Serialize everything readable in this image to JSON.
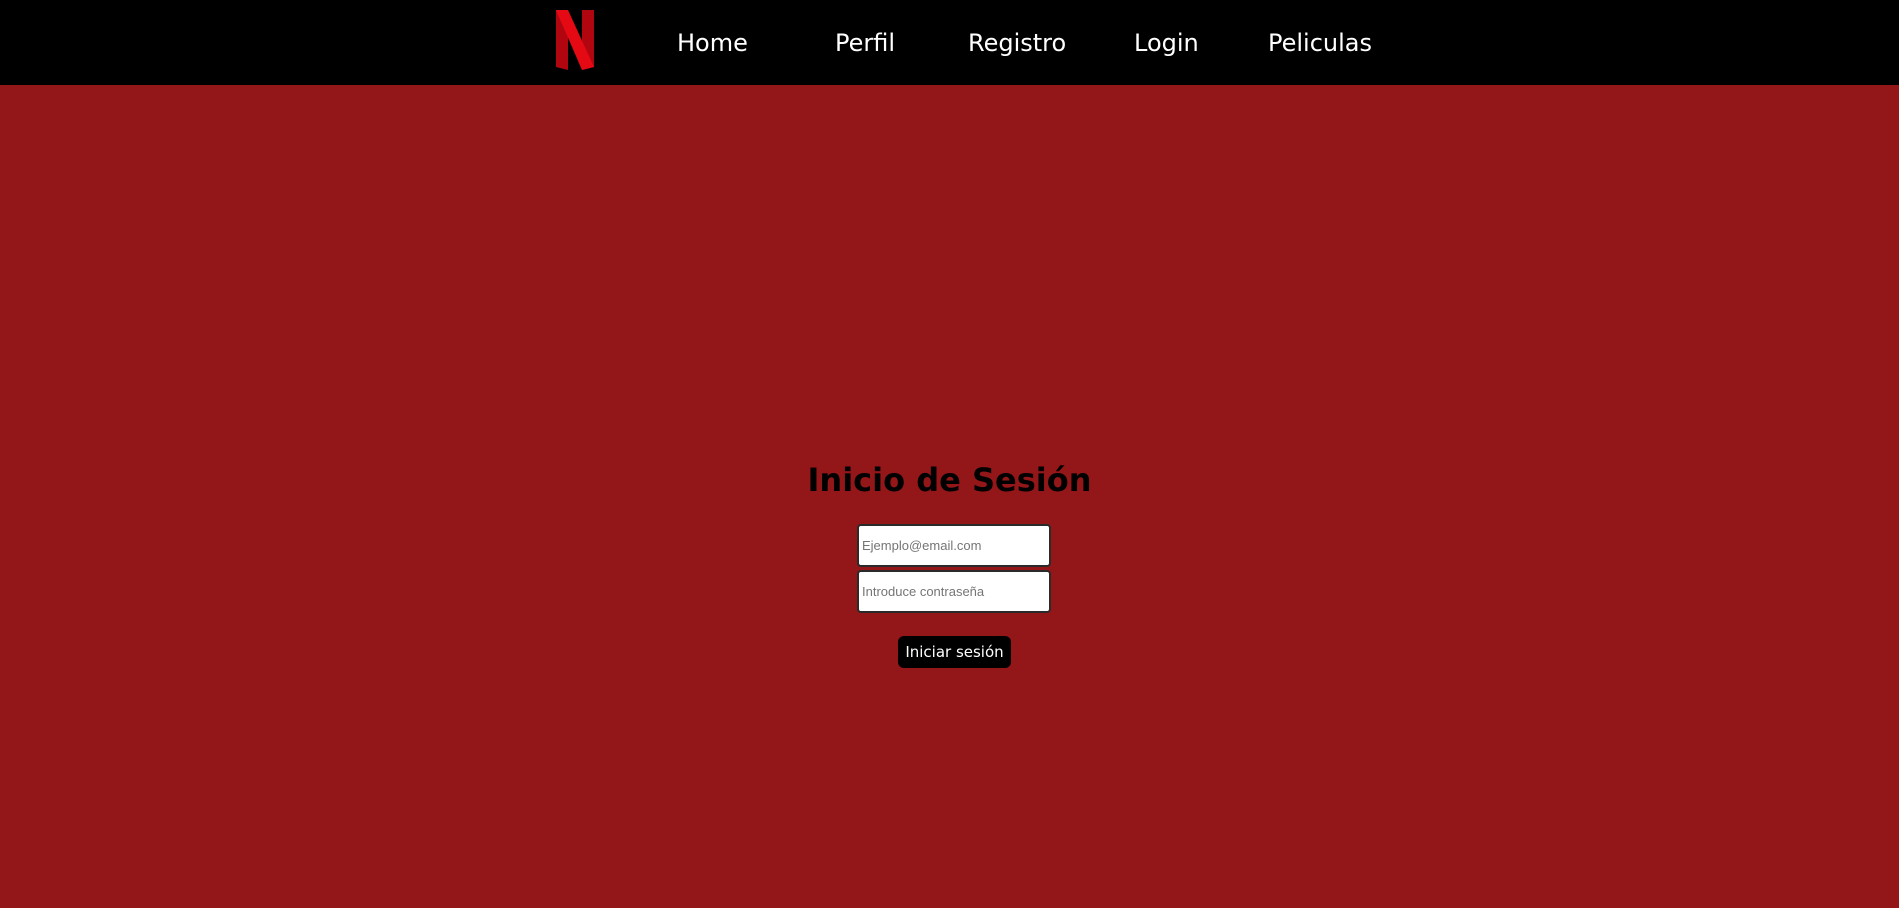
{
  "nav": {
    "items": [
      {
        "label": "Home"
      },
      {
        "label": "Perfil"
      },
      {
        "label": "Registro"
      },
      {
        "label": "Login"
      },
      {
        "label": "Peliculas"
      }
    ]
  },
  "logo": {
    "icon": "netflix-n-logo",
    "color": "#e50914"
  },
  "login": {
    "title": "Inicio de Sesión",
    "email_placeholder": "Ejemplo@email.com",
    "password_placeholder": "Introduce contraseña",
    "submit_label": "Iniciar sesión"
  },
  "colors": {
    "navbar_bg": "#000000",
    "page_bg": "#931618",
    "button_bg": "#000000"
  }
}
